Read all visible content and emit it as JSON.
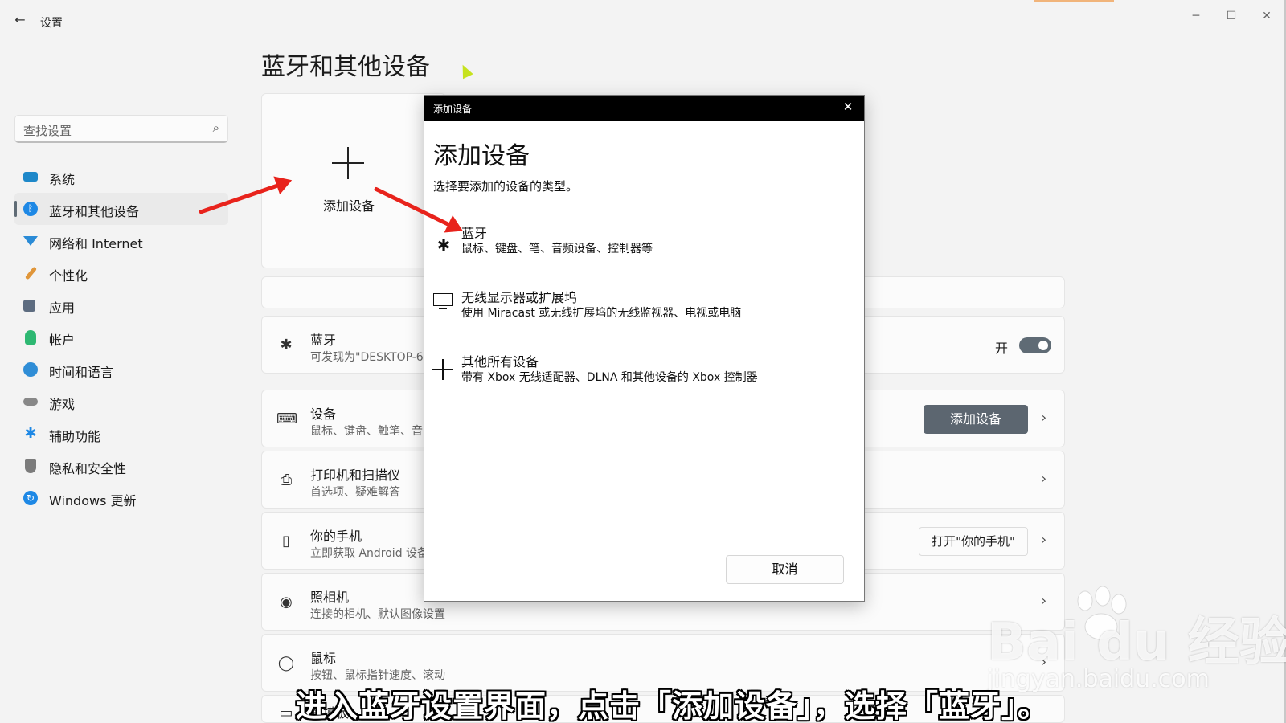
{
  "app": {
    "title": "设置",
    "back_icon": "arrow-left-icon",
    "accent": "#f1b47a"
  },
  "window_controls": {
    "minimize": "─",
    "maximize": "☐",
    "close": "✕"
  },
  "search": {
    "placeholder": "查找设置",
    "icon": "search-icon"
  },
  "sidebar": {
    "items": [
      {
        "label": "系统",
        "icon": "system-icon",
        "color": "#1e88c9",
        "active": false
      },
      {
        "label": "蓝牙和其他设备",
        "icon": "bluetooth-icon",
        "color": "#1e88e5",
        "active": true
      },
      {
        "label": "网络和 Internet",
        "icon": "wifi-icon",
        "color": "#2a8bd6",
        "active": false
      },
      {
        "label": "个性化",
        "icon": "brush-icon",
        "color": "#e0963a",
        "active": false
      },
      {
        "label": "应用",
        "icon": "apps-icon",
        "color": "#5d6c80",
        "active": false
      },
      {
        "label": "帐户",
        "icon": "account-icon",
        "color": "#2eb872",
        "active": false
      },
      {
        "label": "时间和语言",
        "icon": "globe-clock-icon",
        "color": "#2f8dd6",
        "active": false
      },
      {
        "label": "游戏",
        "icon": "gamepad-icon",
        "color": "#888888",
        "active": false
      },
      {
        "label": "辅助功能",
        "icon": "accessibility-icon",
        "color": "#1e88e5",
        "active": false
      },
      {
        "label": "隐私和安全性",
        "icon": "shield-icon",
        "color": "#7b7b7b",
        "active": false
      },
      {
        "label": "Windows 更新",
        "icon": "update-icon",
        "color": "#1e88e5",
        "active": false
      }
    ]
  },
  "main": {
    "title": "蓝牙和其他设备",
    "add_card": {
      "label": "添加设备"
    },
    "rows": [
      {
        "name": "bluetooth",
        "title": "蓝牙",
        "sub": "可发现为\"DESKTOP-6",
        "icon": "✱",
        "toggle_label": "开"
      },
      {
        "name": "devices",
        "title": "设备",
        "sub": "鼠标、键盘、触笔、音",
        "icon": "⌨",
        "button": "添加设备"
      },
      {
        "name": "printers",
        "title": "打印机和扫描仪",
        "sub": "首选项、疑难解答",
        "icon": "⎙"
      },
      {
        "name": "phone",
        "title": "你的手机",
        "sub": "立即获取 Android 设备",
        "icon": "▯",
        "button": "打开\"你的手机\""
      },
      {
        "name": "camera",
        "title": "照相机",
        "sub": "连接的相机、默认图像设置",
        "icon": "◉"
      },
      {
        "name": "mouse",
        "title": "鼠标",
        "sub": "按钮、鼠标指针速度、滚动",
        "icon": "◯"
      },
      {
        "name": "touchpad",
        "title": "触摸板",
        "sub": "",
        "icon": "▭"
      }
    ]
  },
  "dialog": {
    "titlebar": "添加设备",
    "heading": "添加设备",
    "prompt": "选择要添加的设备的类型。",
    "options": [
      {
        "title": "蓝牙",
        "sub": "鼠标、键盘、笔、音频设备、控制器等",
        "icon": "bluetooth-icon"
      },
      {
        "title": "无线显示器或扩展坞",
        "sub": "使用 Miracast 或无线扩展坞的无线监视器、电视或电脑",
        "icon": "monitor-icon"
      },
      {
        "title": "其他所有设备",
        "sub": "带有 Xbox 无线适配器、DLNA 和其他设备的 Xbox 控制器",
        "icon": "plus-icon"
      }
    ],
    "cancel": "取消"
  },
  "overlay": {
    "caption": "进入蓝牙设置界面，点击「添加设备」，选择「蓝牙」。",
    "watermark_brand": "Bai du 经验",
    "watermark_url": "jingyan.baidu.com",
    "arrow_color": "#e8231c"
  }
}
